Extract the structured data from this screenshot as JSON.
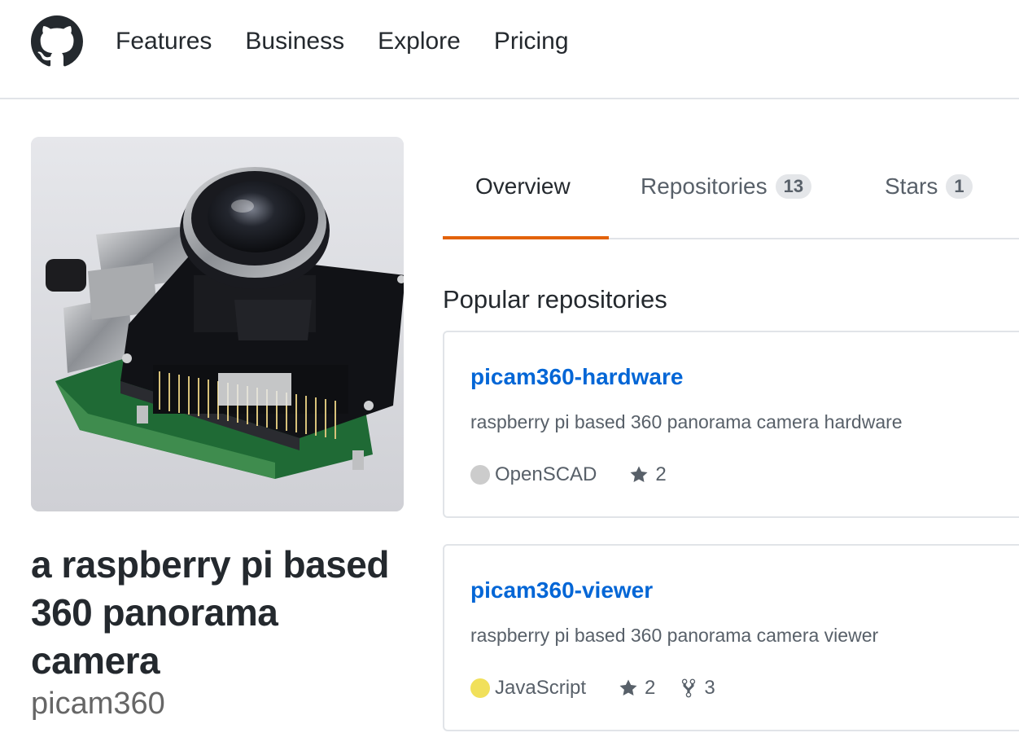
{
  "header": {
    "nav": [
      "Features",
      "Business",
      "Explore",
      "Pricing"
    ]
  },
  "profile": {
    "name": "a raspberry pi based 360 panorama camera",
    "login": "picam360"
  },
  "tabs": [
    {
      "label": "Overview",
      "selected": true
    },
    {
      "label": "Repositories",
      "count": "13"
    },
    {
      "label": "Stars",
      "count": "1"
    }
  ],
  "popular": {
    "title": "Popular repositories",
    "repos": [
      {
        "name": "picam360-hardware",
        "description": "raspberry pi based 360 panorama camera hardware",
        "language": "OpenSCAD",
        "language_color": "#cccccc",
        "stars": "2"
      },
      {
        "name": "picam360-viewer",
        "description": "raspberry pi based 360 panorama camera viewer",
        "language": "JavaScript",
        "language_color": "#f1e05a",
        "stars": "2",
        "forks": "3"
      }
    ]
  },
  "colors": {
    "accent": "#e36209",
    "link": "#0366d6",
    "text": "#24292e",
    "muted": "#586069"
  },
  "icons": {
    "logo": "github-octocat-icon",
    "star": "star-icon",
    "fork": "repo-forked-icon"
  }
}
